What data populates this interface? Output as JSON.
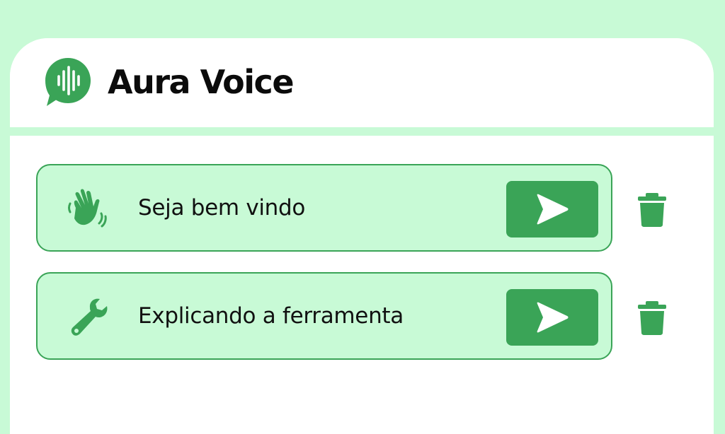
{
  "app": {
    "title": "Aura Voice",
    "logo_icon": "chat-soundwave-icon"
  },
  "colors": {
    "background": "#c8fad6",
    "accent": "#3aa457",
    "card": "#ffffff",
    "text": "#0b0b0b"
  },
  "recordings": [
    {
      "label": "Seja bem vindo",
      "icon": "waving-hand-icon",
      "play_icon": "play-icon",
      "delete_icon": "trash-icon"
    },
    {
      "label": "Explicando a ferramenta",
      "icon": "wrench-icon",
      "play_icon": "play-icon",
      "delete_icon": "trash-icon"
    }
  ]
}
